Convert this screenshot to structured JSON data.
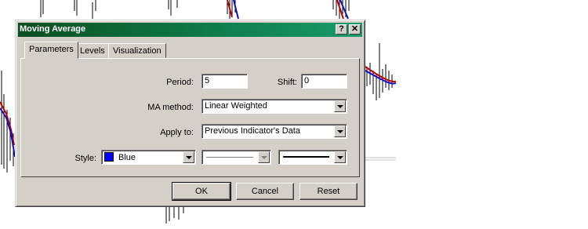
{
  "dialog": {
    "title": "Moving Average",
    "help_glyph": "?",
    "close_glyph": "✕"
  },
  "tabs": [
    {
      "label": "Parameters",
      "active": true
    },
    {
      "label": "Levels",
      "active": false
    },
    {
      "label": "Visualization",
      "active": false
    }
  ],
  "params": {
    "period_label": "Period:",
    "period_value": "5",
    "shift_label": "Shift:",
    "shift_value": "0",
    "method_label": "MA method:",
    "method_value": "Linear Weighted",
    "apply_label": "Apply to:",
    "apply_value": "Previous Indicator's Data",
    "style_label": "Style:",
    "color_value": "Blue",
    "color_hex": "#0000ff"
  },
  "buttons": {
    "ok": "OK",
    "cancel": "Cancel",
    "reset": "Reset"
  }
}
